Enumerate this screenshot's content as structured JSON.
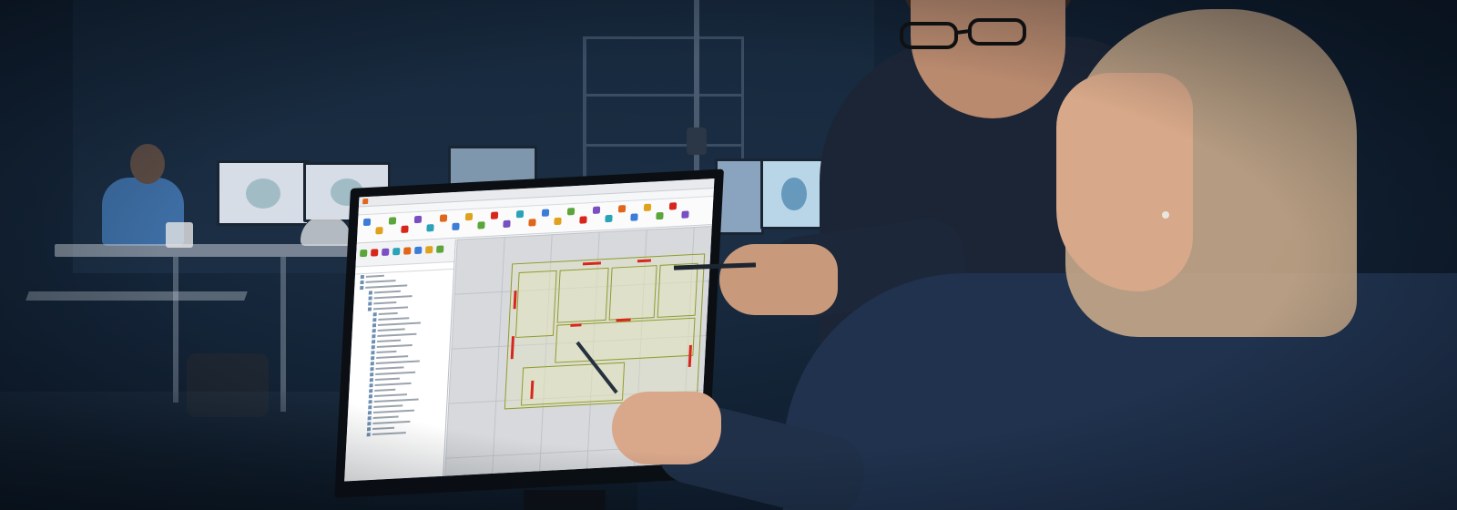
{
  "photo": {
    "subject": "",
    "software_window": {
      "title": "",
      "ribbon_tabs": [],
      "active_tab": ""
    }
  },
  "colors": {
    "background": "#132336",
    "wall_red": "#d9261c",
    "room_outline": "#8f9c2a",
    "app_accent": "#e0661c"
  },
  "icons": {
    "app": "app-logo-icon",
    "ribbon": "ribbon-tool-icon"
  }
}
